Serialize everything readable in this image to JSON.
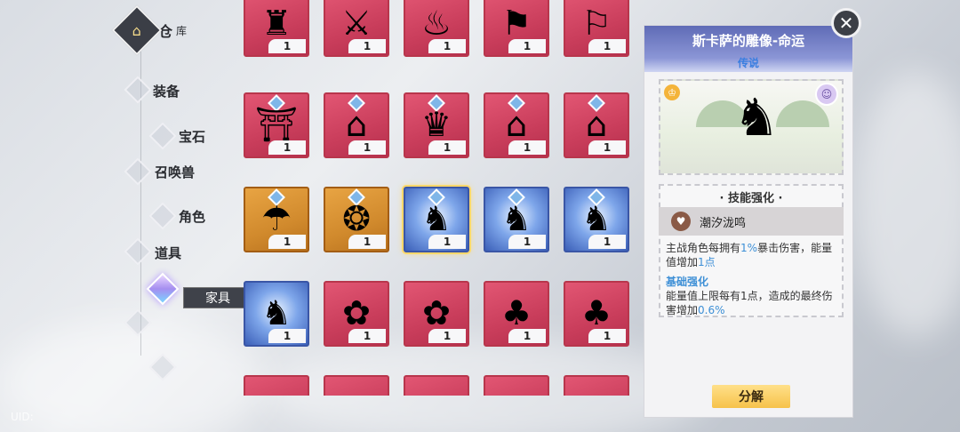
{
  "nav": {
    "warehouse_title": "仓",
    "warehouse_sub": "库",
    "items": [
      {
        "label": "装备"
      },
      {
        "label": "宝石"
      },
      {
        "label": "召唤兽"
      },
      {
        "label": "角色"
      },
      {
        "label": "道具"
      },
      {
        "label": "家具"
      }
    ],
    "active": "家具",
    "uid_label": "UID:"
  },
  "grid": {
    "items": [
      {
        "count": "1",
        "bg": "red",
        "icon": "lamp-post-icon"
      },
      {
        "count": "1",
        "bg": "red",
        "icon": "weapon-rack-icon"
      },
      {
        "count": "1",
        "bg": "red",
        "icon": "fountain-icon"
      },
      {
        "count": "1",
        "bg": "red",
        "icon": "golden-signpost-icon"
      },
      {
        "count": "1",
        "bg": "red",
        "icon": "banner-stand-icon"
      },
      {
        "count": "1",
        "bg": "red",
        "icon": "pavilion-icon"
      },
      {
        "count": "1",
        "bg": "red",
        "icon": "mansion-icon"
      },
      {
        "count": "1",
        "bg": "red",
        "icon": "dragon-house-icon"
      },
      {
        "count": "1",
        "bg": "red",
        "icon": "manor-icon"
      },
      {
        "count": "1",
        "bg": "red",
        "icon": "cottage-icon"
      },
      {
        "count": "1",
        "bg": "gold",
        "icon": "parasol-icon"
      },
      {
        "count": "1",
        "bg": "gold",
        "icon": "ornate-frame-icon"
      },
      {
        "count": "1",
        "bg": "blue",
        "icon": "statue-icon"
      },
      {
        "count": "1",
        "bg": "blue",
        "icon": "statue-icon"
      },
      {
        "count": "1",
        "bg": "blue",
        "icon": "statue-icon"
      },
      {
        "count": "1",
        "bg": "blue",
        "icon": "statue-icon"
      },
      {
        "count": "1",
        "bg": "red",
        "icon": "blossom-tree-icon"
      },
      {
        "count": "1",
        "bg": "red",
        "icon": "blossom-tree-icon"
      },
      {
        "count": "1",
        "bg": "red",
        "icon": "green-lantern-icon"
      },
      {
        "count": "1",
        "bg": "red",
        "icon": "green-lantern-icon"
      }
    ]
  },
  "detail": {
    "title": "斯卡萨的雕像-命运",
    "rarity": "传说",
    "skill_section_title": "技能强化",
    "skill_name": "潮汐泷鸣",
    "skill_desc_1_prefix": "主战角色每拥有",
    "skill_desc_1_value": "1%",
    "skill_desc_1_mid": "暴击伤害，能量值增加",
    "skill_desc_1_value2": "1点",
    "basic_title": "基础强化",
    "basic_desc_prefix": "能量值上限每有1点，造成的最终伤害增加",
    "basic_desc_value": "0.6%",
    "decompose_label": "分解",
    "close_label": "✕"
  },
  "colors": {
    "accent_blue": "#3d8fd6",
    "button_gold": "#f6c24a",
    "card_red": "#c93d5b"
  }
}
